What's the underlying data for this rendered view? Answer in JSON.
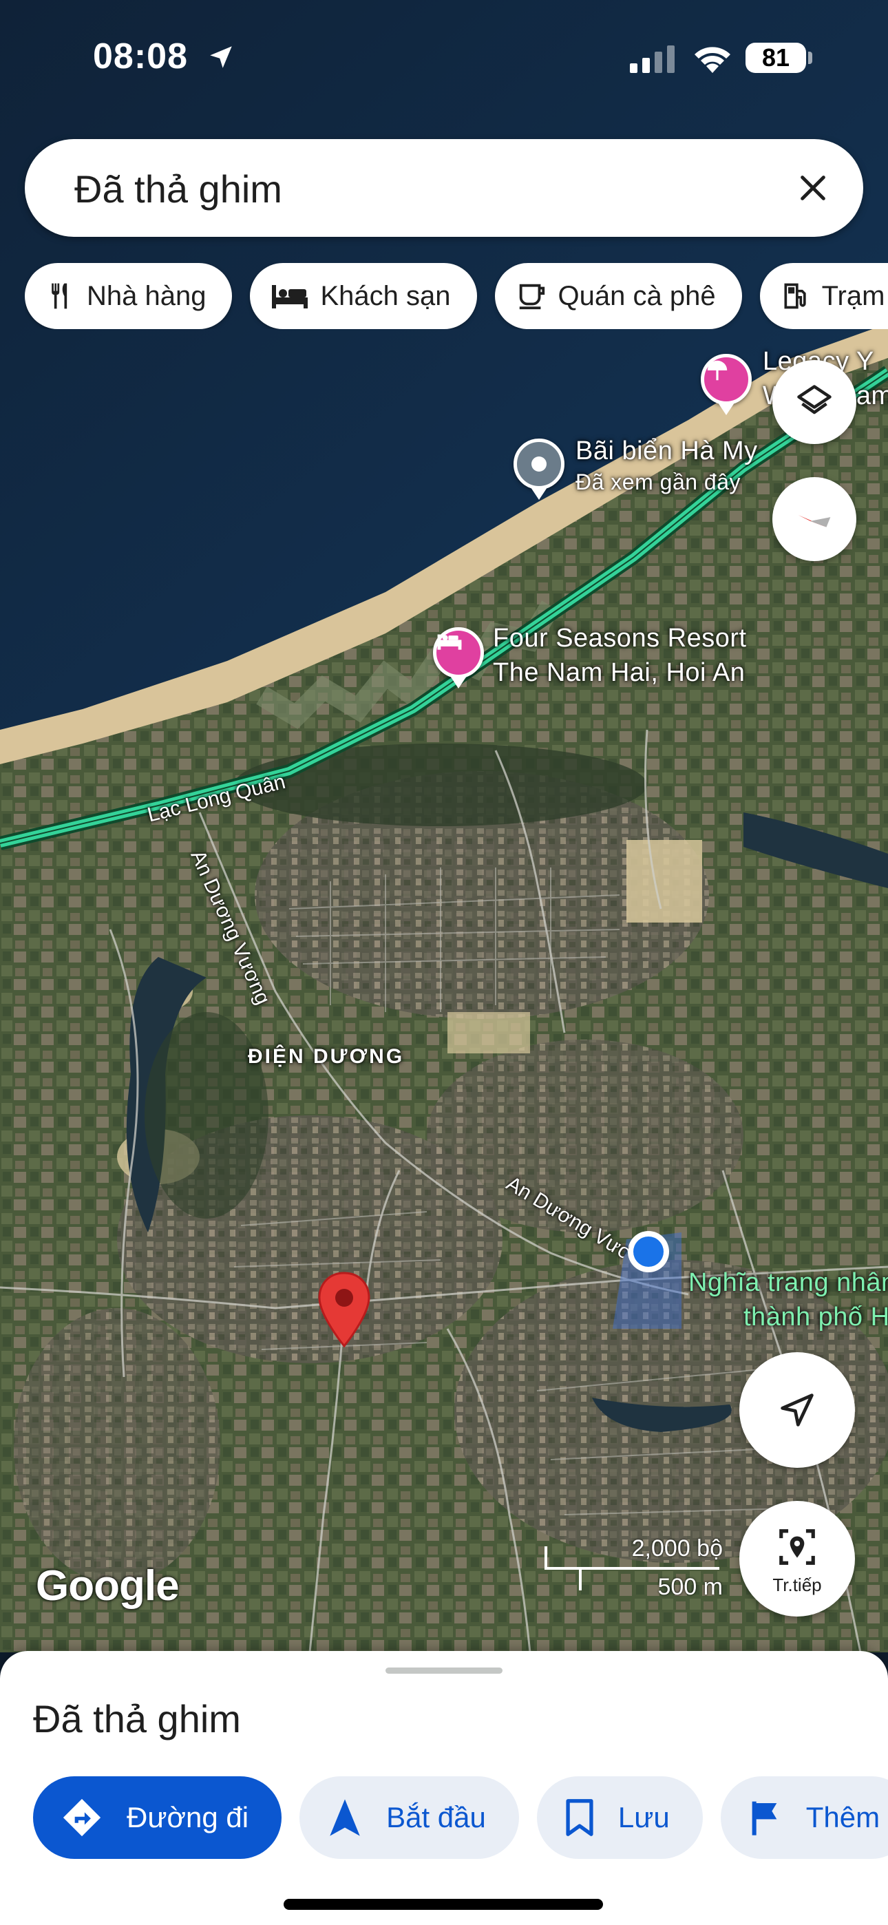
{
  "status_bar": {
    "time": "08:08",
    "battery": "81"
  },
  "search": {
    "query": "Đã thả ghim"
  },
  "chips": [
    {
      "label": "Nhà hàng",
      "icon": "restaurant-icon"
    },
    {
      "label": "Khách sạn",
      "icon": "hotel-icon"
    },
    {
      "label": "Quán cà phê",
      "icon": "coffee-icon"
    },
    {
      "label": "Trạm xăng",
      "icon": "gas-station-icon"
    }
  ],
  "map": {
    "places": {
      "legacy_line1": "Legacy Y",
      "legacy_line2": "W Vietnam",
      "beach_name": "Bãi biển Hà My",
      "beach_sub": "Đã xem gần đây",
      "resort_line1": "Four Seasons Resort",
      "resort_line2": "The Nam Hai, Hoi An",
      "cemetery_line1": "Nghĩa trang nhân",
      "cemetery_line2": "thành phố H"
    },
    "roads": {
      "lac_long_quan": "Lạc Long Quân",
      "an_duong_vuong_1": "An Dương Vương",
      "an_duong_vuong_2": "An Dương Vương"
    },
    "district": "ĐIỆN DƯƠNG",
    "google": "Google",
    "scale_ft": "2,000 bộ",
    "scale_m": "500 m",
    "live_label": "Tr.tiếp",
    "colors": {
      "pin_red": "#e53935",
      "poi_pink": "#e040a0",
      "route_green": "#34d399",
      "user_blue": "#1a73e8"
    }
  },
  "sheet": {
    "title": "Đã thả ghim",
    "actions": [
      {
        "label": "Đường đi",
        "icon": "directions-icon",
        "primary": true
      },
      {
        "label": "Bắt đầu",
        "icon": "navigation-arrow-icon",
        "primary": false
      },
      {
        "label": "Lưu",
        "icon": "bookmark-icon",
        "primary": false
      },
      {
        "label": "Thêm",
        "icon": "flag-icon",
        "primary": false
      }
    ]
  }
}
